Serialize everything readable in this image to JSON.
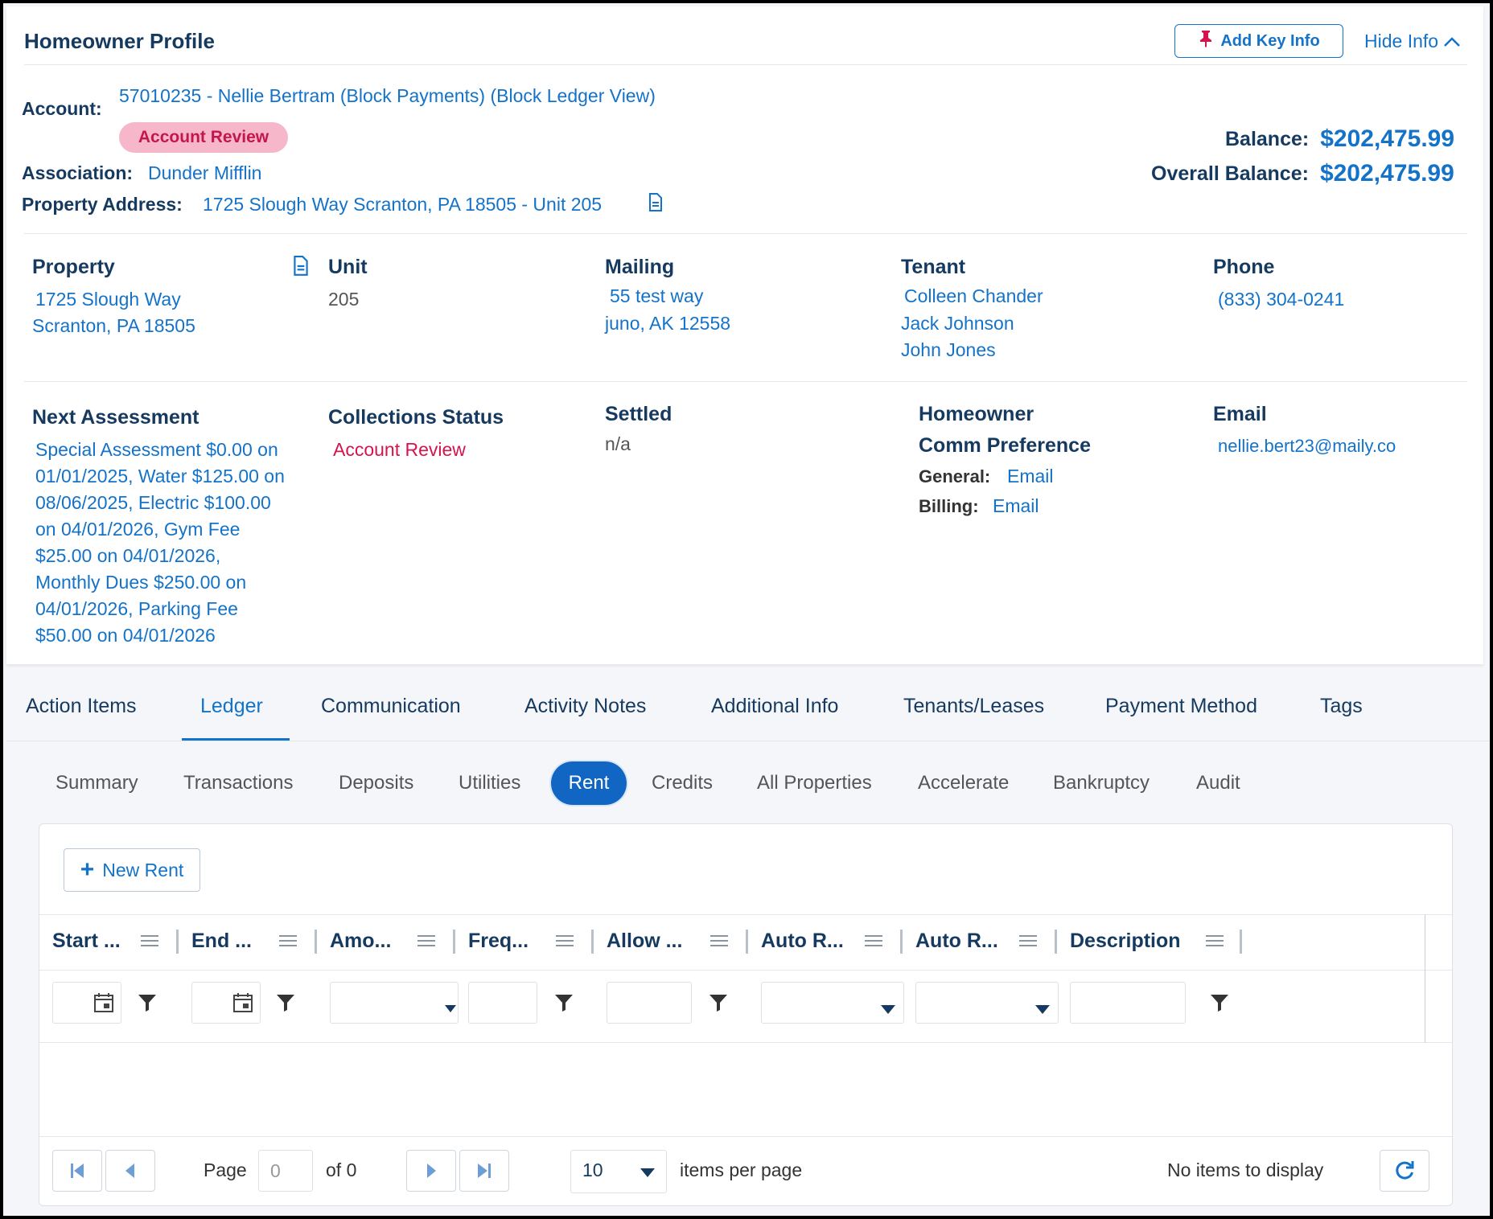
{
  "profile": {
    "title": "Homeowner Profile",
    "add_key_info": "Add Key Info",
    "hide_info": "Hide Info",
    "account_label": "Account:",
    "account_value": "57010235 - Nellie Bertram (Block Payments) (Block Ledger View)",
    "account_badge": "Account Review",
    "association_label": "Association:",
    "association_value": "Dunder Mifflin",
    "property_address_label": "Property Address:",
    "property_address_value": "1725 Slough Way Scranton, PA 18505 - Unit 205",
    "balance_label": "Balance:",
    "balance_value": "$202,475.99",
    "overall_balance_label": "Overall Balance:",
    "overall_balance_value": "$202,475.99"
  },
  "details": {
    "property": {
      "label": "Property",
      "line1": "1725 Slough Way",
      "line2": "Scranton, PA 18505"
    },
    "unit": {
      "label": "Unit",
      "value": "205"
    },
    "mailing": {
      "label": "Mailing",
      "line1": "55 test way",
      "line2": "juno, AK 12558"
    },
    "tenant": {
      "label": "Tenant",
      "names": [
        "Colleen Chander",
        "Jack Johnson",
        "John Jones"
      ]
    },
    "phone": {
      "label": "Phone",
      "value": "(833) 304-0241"
    },
    "next_assessment": {
      "label": "Next Assessment",
      "lines": [
        "Special Assessment $0.00 on",
        "01/01/2025, Water $125.00 on",
        "08/06/2025, Electric $100.00",
        "on 04/01/2026, Gym Fee",
        "$25.00 on 04/01/2026,",
        "Monthly Dues $250.00 on",
        "04/01/2026, Parking Fee",
        "$50.00 on 04/01/2026"
      ]
    },
    "collections_status": {
      "label": "Collections Status",
      "value": "Account Review"
    },
    "settled": {
      "label": "Settled",
      "value": "n/a"
    },
    "comm_pref": {
      "label1": "Homeowner",
      "label2": "Comm Preference",
      "general_label": "General:",
      "general_value": "Email",
      "billing_label": "Billing:",
      "billing_value": "Email"
    },
    "email": {
      "label": "Email",
      "value": "nellie.bert23@maily.co"
    }
  },
  "tabs": [
    "Action Items",
    "Ledger",
    "Communication",
    "Activity Notes",
    "Additional Info",
    "Tenants/Leases",
    "Payment Method",
    "Tags"
  ],
  "active_tab": "Ledger",
  "subtabs": [
    "Summary",
    "Transactions",
    "Deposits",
    "Utilities",
    "Rent",
    "Credits",
    "All Properties",
    "Accelerate",
    "Bankruptcy",
    "Audit"
  ],
  "active_subtab": "Rent",
  "grid": {
    "new_button": "New Rent",
    "columns": [
      "Start ...",
      "End ...",
      "Amo...",
      "Freq...",
      "Allow ...",
      "Auto R...",
      "Auto R...",
      "Description"
    ],
    "pager": {
      "page_label": "Page",
      "page_value": "0",
      "of_label": "of 0",
      "page_size": "10",
      "per_page_label": "items per page",
      "empty_message": "No items to display"
    }
  },
  "colors": {
    "accent": "#1473c8",
    "navy": "#163a5f",
    "badge_bg": "#f6b7cb",
    "badge_text": "#c4164d",
    "active_pill": "#1166c4"
  }
}
